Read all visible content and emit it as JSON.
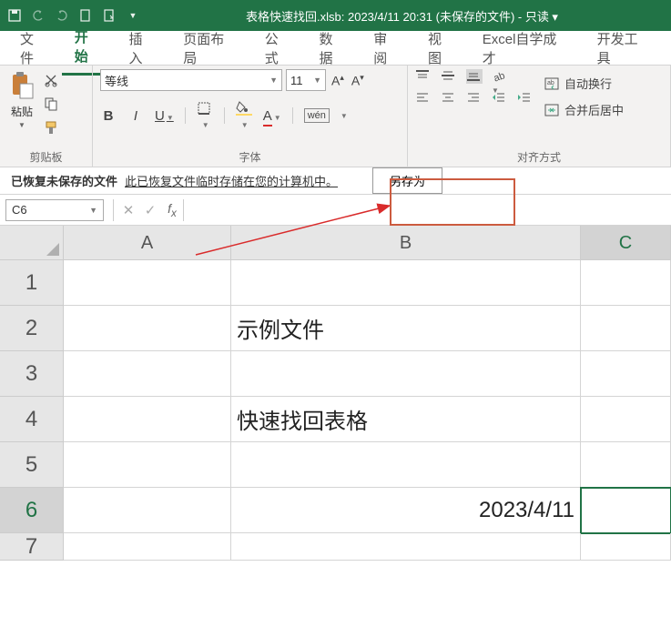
{
  "titlebar": {
    "title": "表格快速找回.xlsb: 2023/4/11 20:31 (未保存的文件)  -  只读 ▾"
  },
  "tabs": {
    "file": "文件",
    "home": "开始",
    "insert": "插入",
    "layout": "页面布局",
    "formula": "公式",
    "data": "数据",
    "review": "审阅",
    "view": "视图",
    "custom": "Excel自学成才",
    "dev": "开发工具"
  },
  "ribbon": {
    "clipboard": {
      "label": "剪贴板",
      "paste": "粘贴"
    },
    "font": {
      "label": "字体",
      "name": "等线",
      "size": "11",
      "bold": "B",
      "italic": "I",
      "underline": "U",
      "wen": "wén"
    },
    "align": {
      "label": "对齐方式",
      "wrap": "自动换行",
      "merge": "合并后居中"
    }
  },
  "recover": {
    "bold": "已恢复未保存的文件",
    "msg": "此已恢复文件临时存储在您的计算机中。",
    "saveas": "另存为"
  },
  "formula_bar": {
    "namebox": "C6"
  },
  "grid": {
    "cols": {
      "A": "A",
      "B": "B",
      "C": "C"
    },
    "rows": {
      "1": "1",
      "2": "2",
      "3": "3",
      "4": "4",
      "5": "5",
      "6": "6",
      "7": "7"
    },
    "cells": {
      "B2": "示例文件",
      "B4": "快速找回表格",
      "B6": "2023/4/11"
    },
    "selected": "C6"
  }
}
